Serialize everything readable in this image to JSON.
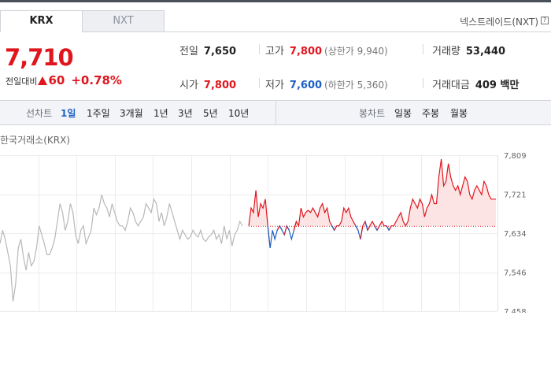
{
  "tabs": [
    {
      "label": "KRX",
      "active": true
    },
    {
      "label": "NXT",
      "active": false
    }
  ],
  "nxt_link": "넥스트레이드(NXT)",
  "help_icon": "?",
  "price": {
    "current": "7,710",
    "change_label": "전일대비",
    "change_icon": "up-triangle-icon",
    "change_value": "60",
    "change_rate": "+0.78%",
    "color": "#e0161e"
  },
  "stats": {
    "prev_close": {
      "label": "전일",
      "value": "7,650"
    },
    "high": {
      "label": "고가",
      "value": "7,800",
      "sub": "(상한가 9,940)"
    },
    "volume": {
      "label": "거래량",
      "value": "53,440"
    },
    "open": {
      "label": "시가",
      "value": "7,800"
    },
    "low": {
      "label": "저가",
      "value": "7,600",
      "sub": "(하한가 5,360)"
    },
    "trade_value": {
      "label": "거래대금",
      "value": "409 백만"
    }
  },
  "toolbar": {
    "line_label": "선차트",
    "line_periods": [
      "1일",
      "1주일",
      "3개월",
      "1년",
      "3년",
      "5년",
      "10년"
    ],
    "selected_period": "1일",
    "candle_label": "봉차트",
    "candle_periods": [
      "일봉",
      "주봉",
      "월봉"
    ]
  },
  "chart_source": "한국거래소(KRX)",
  "colors": {
    "up": "#e0161e",
    "down": "#1d60c5",
    "gray_line": "#b8b8b8",
    "baseline": "#e0161e",
    "up_fill": "#fde4e4"
  },
  "chart_data": {
    "type": "line",
    "title": "",
    "xlabel": "",
    "ylabel": "",
    "ylim": [
      7458,
      7809
    ],
    "y_ticks": [
      "7,809",
      "7,721",
      "7,634",
      "7,546",
      "7,458"
    ],
    "baseline": 7650,
    "grid": true,
    "series": [
      {
        "name": "",
        "color": "#b8b8b8",
        "values": [
          7610,
          7640,
          7620,
          7590,
          7560,
          7480,
          7520,
          7600,
          7620,
          7580,
          7550,
          7590,
          7560,
          7570,
          7600,
          7650,
          7630,
          7610,
          7585,
          7585,
          7600,
          7620,
          7660,
          7700,
          7680,
          7640,
          7660,
          7700,
          7680,
          7630,
          7610,
          7640,
          7650,
          7610,
          7625,
          7640,
          7690,
          7675,
          7690,
          7720,
          7700,
          7690,
          7670,
          7700,
          7680,
          7660,
          7650,
          7650,
          7640,
          7660,
          7690,
          7680,
          7660,
          7650,
          7660,
          7670,
          7700,
          7690,
          7680,
          7710,
          7700,
          7660,
          7680,
          7650,
          7670,
          7700,
          7680,
          7660,
          7640,
          7620,
          7640,
          7630,
          7620,
          7625,
          7640,
          7630,
          7625,
          7640,
          7620,
          7615,
          7625,
          7630,
          7640,
          7620,
          7630,
          7610,
          7650,
          7620,
          7640,
          7605,
          7630,
          7640,
          7660,
          7650
        ]
      },
      {
        "name": "",
        "color": "#e0161e",
        "values": [
          7650,
          7690,
          7680,
          7730,
          7670,
          7700,
          7690,
          7710,
          7650,
          7600,
          7640,
          7620,
          7640,
          7650,
          7640,
          7630,
          7650,
          7640,
          7620,
          7640,
          7660,
          7650,
          7690,
          7670,
          7680,
          7685,
          7680,
          7690,
          7680,
          7670,
          7690,
          7700,
          7680,
          7690,
          7660,
          7650,
          7640,
          7650,
          7650,
          7660,
          7690,
          7680,
          7690,
          7670,
          7660,
          7650,
          7640,
          7620,
          7650,
          7660,
          7640,
          7650,
          7660,
          7650,
          7640,
          7650,
          7660,
          7650,
          7650,
          7640,
          7650,
          7650,
          7660,
          7670,
          7680,
          7660,
          7650,
          7660,
          7690,
          7710,
          7700,
          7690,
          7710,
          7700,
          7670,
          7690,
          7700,
          7720,
          7700,
          7700,
          7760,
          7800,
          7740,
          7750,
          7790,
          7760,
          7740,
          7730,
          7740,
          7720,
          7740,
          7760,
          7750,
          7720,
          7710,
          7730,
          7740,
          7730,
          7720,
          7750,
          7740,
          7720,
          7710,
          7710,
          7710
        ]
      }
    ]
  }
}
